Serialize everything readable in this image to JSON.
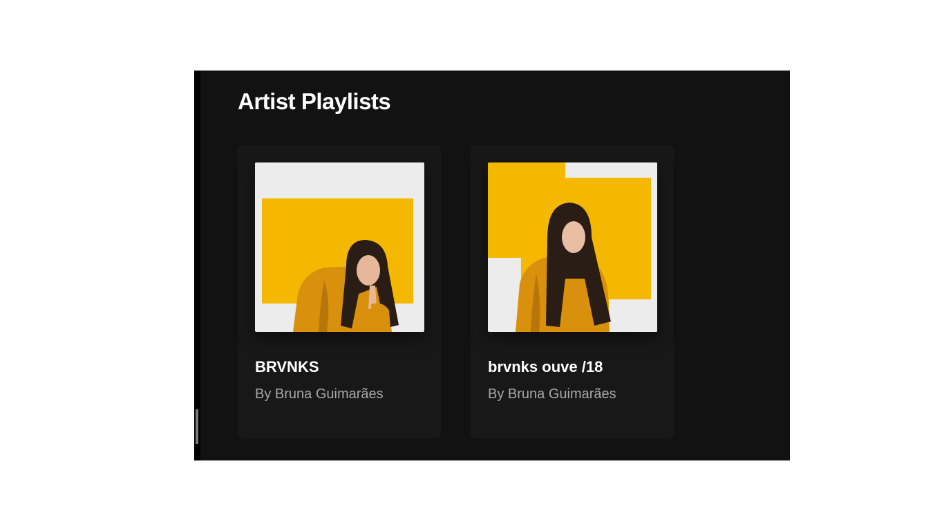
{
  "section": {
    "title": "Artist Playlists"
  },
  "playlists": [
    {
      "title": "BRVNKS",
      "subtitle": "By Bruna Guimarães"
    },
    {
      "title": "brvnks ouve /18",
      "subtitle": "By Bruna Guimarães"
    }
  ],
  "colors": {
    "panel_background": "#121212",
    "card_background": "#181818",
    "title_text": "#ffffff",
    "subtitle_text": "#a7a7a7",
    "cover_yellow": "#f5b800",
    "cover_white": "#ededed",
    "jacket_mustard": "#d9900c"
  }
}
